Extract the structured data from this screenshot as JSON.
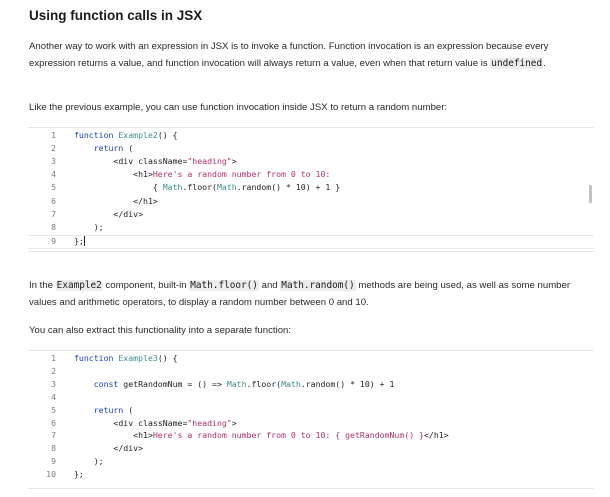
{
  "title": "Using function calls in JSX",
  "intro": {
    "text1": "Another way to work with an expression in JSX is to invoke a function. Function invocation is an expression because every expression returns a value, and function invocation will always return a value, even when that return value is ",
    "code": "undefined",
    "text2": "."
  },
  "para2": "Like the previous example, you can use function invocation inside JSX to return a random number:",
  "code1": {
    "lines": [
      {
        "n": "1",
        "parts": [
          {
            "t": "function ",
            "c": "kw"
          },
          {
            "t": "Example2",
            "c": "jsx"
          },
          {
            "t": "() {",
            "c": ""
          }
        ]
      },
      {
        "n": "2",
        "parts": [
          {
            "t": "    ",
            "c": ""
          },
          {
            "t": "return",
            "c": "kw"
          },
          {
            "t": " (",
            "c": ""
          }
        ]
      },
      {
        "n": "3",
        "parts": [
          {
            "t": "        <div className=",
            "c": ""
          },
          {
            "t": "\"heading\"",
            "c": "str"
          },
          {
            "t": ">",
            "c": ""
          }
        ]
      },
      {
        "n": "4",
        "parts": [
          {
            "t": "            <h1>",
            "c": ""
          },
          {
            "t": "Here's a random number from 0 to 10:",
            "c": "str"
          }
        ]
      },
      {
        "n": "5",
        "parts": [
          {
            "t": "                { ",
            "c": ""
          },
          {
            "t": "Math",
            "c": "jsx"
          },
          {
            "t": ".floor(",
            "c": ""
          },
          {
            "t": "Math",
            "c": "jsx"
          },
          {
            "t": ".random() * 10) + 1 }",
            "c": ""
          }
        ]
      },
      {
        "n": "6",
        "parts": [
          {
            "t": "            </h1>",
            "c": ""
          }
        ]
      },
      {
        "n": "7",
        "parts": [
          {
            "t": "        </div>",
            "c": ""
          }
        ]
      },
      {
        "n": "8",
        "parts": [
          {
            "t": "    );",
            "c": ""
          }
        ]
      },
      {
        "n": "9",
        "parts": [
          {
            "t": "};",
            "c": ""
          }
        ]
      }
    ]
  },
  "para3": {
    "a": "In the ",
    "code1": "Example2",
    "b": " component, built-in ",
    "code2": "Math.floor()",
    "c": " and ",
    "code3": "Math.random()",
    "d": " methods are being used, as well as some number values and arithmetic operators, to display a random number between 0 and 10."
  },
  "para4": "You can also extract this functionality into a separate function:",
  "code2": {
    "lines": [
      {
        "n": "1",
        "parts": [
          {
            "t": "function ",
            "c": "kw"
          },
          {
            "t": "Example3",
            "c": "jsx"
          },
          {
            "t": "() {",
            "c": ""
          }
        ]
      },
      {
        "n": "2",
        "parts": []
      },
      {
        "n": "3",
        "parts": [
          {
            "t": "    ",
            "c": ""
          },
          {
            "t": "const",
            "c": "kw"
          },
          {
            "t": " getRandomNum = () => ",
            "c": ""
          },
          {
            "t": "Math",
            "c": "jsx"
          },
          {
            "t": ".floor(",
            "c": ""
          },
          {
            "t": "Math",
            "c": "jsx"
          },
          {
            "t": ".random() * 10) + 1",
            "c": ""
          }
        ]
      },
      {
        "n": "4",
        "parts": []
      },
      {
        "n": "5",
        "parts": [
          {
            "t": "    ",
            "c": ""
          },
          {
            "t": "return",
            "c": "kw"
          },
          {
            "t": " (",
            "c": ""
          }
        ]
      },
      {
        "n": "6",
        "parts": [
          {
            "t": "        <div className=",
            "c": ""
          },
          {
            "t": "\"heading\"",
            "c": "str"
          },
          {
            "t": ">",
            "c": ""
          }
        ]
      },
      {
        "n": "7",
        "parts": [
          {
            "t": "            <h1>",
            "c": ""
          },
          {
            "t": "Here's a random number from 0 to 10: { getRandomNum() }",
            "c": "str"
          },
          {
            "t": "</h1>",
            "c": ""
          }
        ]
      },
      {
        "n": "8",
        "parts": [
          {
            "t": "        </div>",
            "c": ""
          }
        ]
      },
      {
        "n": "9",
        "parts": [
          {
            "t": "    );",
            "c": ""
          }
        ]
      },
      {
        "n": "10",
        "parts": [
          {
            "t": "};",
            "c": ""
          }
        ]
      }
    ]
  }
}
